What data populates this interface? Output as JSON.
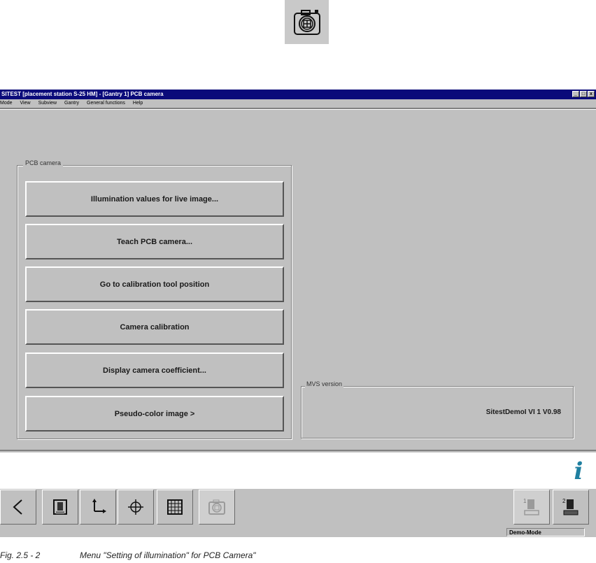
{
  "window": {
    "title": "SITEST [placement station S-25 HM] - [Gantry 1] PCB camera",
    "controls": [
      "_",
      "□",
      "x"
    ]
  },
  "menu": [
    "Mode",
    "View",
    "Subview",
    "Gantry",
    "General functions",
    "Help"
  ],
  "group": {
    "label": "PCB camera",
    "buttons": [
      "Illumination values for live image...",
      "Teach PCB camera...",
      "Go to calibration tool position",
      "Camera calibration",
      "Display camera coefficient...",
      "Pseudo-color image >"
    ]
  },
  "mvs": {
    "label": "MVS version",
    "value": "SitestDemoI VI 1 V0.98"
  },
  "toolbar": {
    "left_icons": [
      "back-arrow-icon",
      "station-icon",
      "axes-icon",
      "crosshair-icon",
      "grid-icon",
      "camera-icon"
    ],
    "right_icons": [
      "gantry-1-icon",
      "gantry-2-icon"
    ]
  },
  "status": {
    "mode": "Demo-Mode"
  },
  "caption": {
    "figure": "Fig. 2.5 - 2",
    "text": "Menu \"Setting of illumination\" for PCB Camera\""
  },
  "colors": {
    "window_bg": "#c0c0c0",
    "titlebar": "#0a0a7a",
    "info_icon": "#1f7fa0"
  }
}
